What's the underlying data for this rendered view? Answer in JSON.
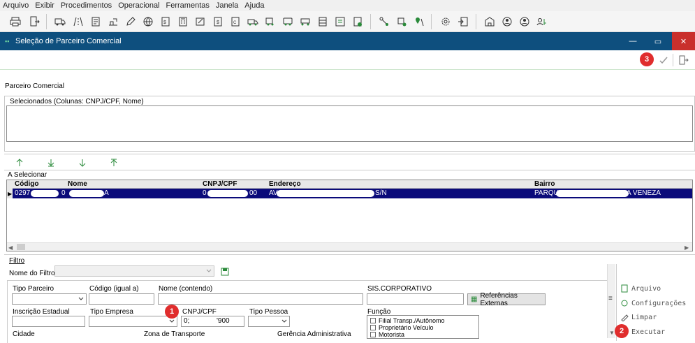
{
  "menu": [
    "Arquivo",
    "Exibir",
    "Procedimentos",
    "Operacional",
    "Ferramentas",
    "Janela",
    "Ajuda"
  ],
  "toolbar_icons": [
    "printer-icon",
    "export-icon",
    "truck-icon",
    "road-icon",
    "document-icon",
    "route-icon",
    "pen-icon",
    "globe-icon",
    "invoice-icon",
    "calculator-icon",
    "edit-doc-icon",
    "cash-doc-icon",
    "report-icon",
    "truck-green-icon",
    "truck-loaded-icon",
    "bus-icon",
    "truck-cargo-icon",
    "truck-box-icon",
    "calendar-grid-icon",
    "money-docs-icon",
    "phone-doc-icon",
    "network-icon",
    "box-network-icon",
    "map-pin-icon",
    "gear-icon",
    "import-icon",
    "building-icon",
    "user-circle-icon",
    "user-icon",
    "users-key-icon"
  ],
  "window": {
    "title": "Seleção de Parceiro Comercial",
    "minimize": "—",
    "maximize": "▭",
    "close": "✕"
  },
  "badges": {
    "one": "1",
    "two": "2",
    "three": "3"
  },
  "section_title": "Parceiro Comercial",
  "selected_label": "Selecionados   (Colunas: CNPJ/CPF, Nome)",
  "to_select_label": "A Selecionar",
  "grid": {
    "columns": [
      "Código",
      "Nome",
      "CNPJ/CPF",
      "Endereço",
      "Bairro"
    ],
    "row": {
      "codigo": "0297",
      "codigo_end": "0",
      "nome": "",
      "nome_end": "A",
      "cnpj": "0",
      "cnpj_end": "00",
      "endereco": "AV",
      "endereco_end": "S/N",
      "bairro": "PARQU",
      "bairro_end": "A VENEZA"
    }
  },
  "filter": {
    "legend": "Filtro",
    "filter_name_label": "Nome do Filtro",
    "tipo_parceiro": "Tipo Parceiro",
    "codigo": "Código (igual a)",
    "nome": "Nome (contendo)",
    "sis": "SIS.CORPORATIVO",
    "ref_button": "Referências Externas",
    "ie": "Inscrição Estadual",
    "tipo_empresa": "Tipo Empresa",
    "cnpj": "CNPJ/CPF",
    "cnpj_value_start": "0;",
    "cnpj_value_end": "'900",
    "tipo_pessoa": "Tipo Pessoa",
    "funcao": "Função",
    "funcao_items": [
      "Filial Transp./Autônomo",
      "Proprietário Veículo",
      "Motorista"
    ],
    "cidade": "Cidade",
    "zona": "Zona de Transporte",
    "gerencia": "Gerência Administrativa"
  },
  "side_actions": [
    "Arquivo",
    "Configurações",
    "Limpar",
    "Executar"
  ]
}
